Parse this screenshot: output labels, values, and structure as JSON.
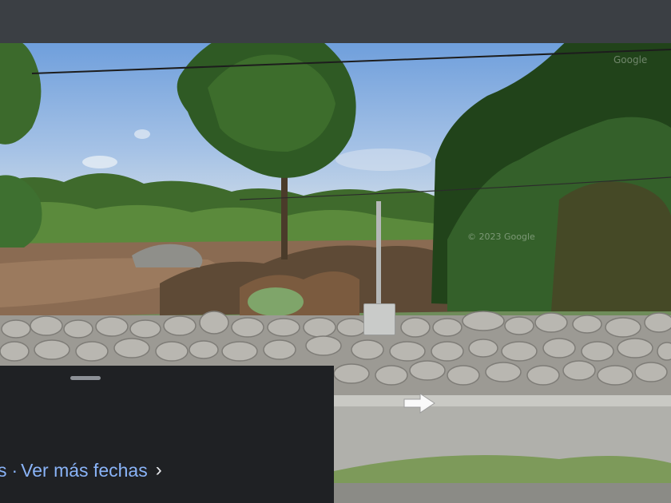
{
  "streetview": {
    "watermark_1": "Google",
    "watermark_2": "© 2023 Google"
  },
  "panel": {
    "dates_prefix": "s",
    "dates_sep": "·",
    "more_dates_label": "Ver más fechas",
    "chevron": "›"
  },
  "icons": {
    "nav_arrow": "navigation-arrow-icon",
    "chevron": "chevron-right-icon"
  },
  "colors": {
    "link": "#8ab4f8",
    "panel_bg": "#1f2124"
  }
}
